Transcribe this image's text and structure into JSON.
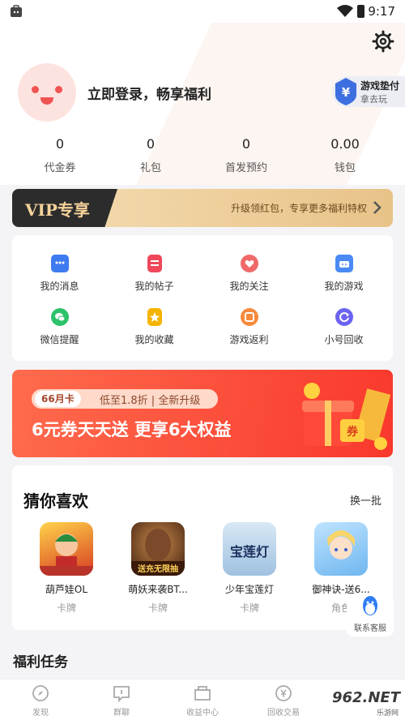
{
  "status_bar": {
    "time": "9:17"
  },
  "profile": {
    "login_text": "立即登录，畅享福利",
    "game_pay": {
      "title": "游戏垫付",
      "subtitle": "拿去玩",
      "symbol": "¥"
    }
  },
  "stats": [
    {
      "value": "0",
      "label": "代金券"
    },
    {
      "value": "0",
      "label": "礼包"
    },
    {
      "value": "0",
      "label": "首发预约"
    },
    {
      "value": "0.00",
      "label": "钱包"
    }
  ],
  "vip": {
    "title": "VIP专享",
    "desc": "升级领红包，专享更多福利特权"
  },
  "menu": [
    {
      "label": "我的消息",
      "icon": "message-icon",
      "color": "#3f7bf0"
    },
    {
      "label": "我的帖子",
      "icon": "post-icon",
      "color": "#f0475a"
    },
    {
      "label": "我的关注",
      "icon": "heart-icon",
      "color": "#f06a6a"
    },
    {
      "label": "我的游戏",
      "icon": "game-icon",
      "color": "#4a8af4"
    },
    {
      "label": "微信提醒",
      "icon": "wechat-icon",
      "color": "#2dc26b"
    },
    {
      "label": "我的收藏",
      "icon": "star-icon",
      "color": "#f5b400"
    },
    {
      "label": "游戏返利",
      "icon": "rebate-icon",
      "color": "#f58a3c"
    },
    {
      "label": "小号回收",
      "icon": "recycle-icon",
      "color": "#6c63f0"
    }
  ],
  "banner": {
    "card": "66月卡",
    "subtitle": "低至1.8折 | 全新升级",
    "headline": "6元券天天送 更享6大权益",
    "coupon": "券"
  },
  "guess": {
    "title": "猜你喜欢",
    "switch_label": "换一批",
    "games": [
      {
        "name": "葫芦娃OL",
        "type": "卡牌"
      },
      {
        "name": "萌妖来袭BT...",
        "type": "卡牌",
        "art_text": "送充无限抽"
      },
      {
        "name": "少年宝莲灯",
        "type": "卡牌",
        "art_text": "宝莲灯"
      },
      {
        "name": "御神诀-送6...",
        "type": "角色"
      }
    ]
  },
  "customer_service": {
    "label": "联系客服"
  },
  "welfare": {
    "title": "福利任务"
  },
  "tabs": [
    {
      "label": "发现",
      "icon": "compass-icon"
    },
    {
      "label": "群聊",
      "icon": "chat-icon"
    },
    {
      "label": "收益中心",
      "icon": "earnings-icon"
    },
    {
      "label": "回收交易",
      "icon": "trade-icon"
    }
  ],
  "watermark": {
    "brand": "962.NET",
    "sub": "乐游网"
  }
}
